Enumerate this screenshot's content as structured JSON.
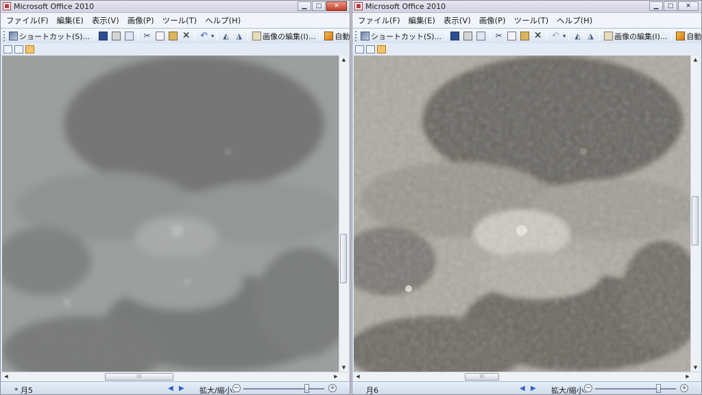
{
  "left": {
    "title": "Microsoft Office 2010",
    "title_buttons": {
      "minimize": "▁",
      "maximize": "□",
      "close": "✕"
    },
    "menus": [
      "ファイル(F)",
      "編集(E)",
      "表示(V)",
      "画像(P)",
      "ツール(T)",
      "ヘルプ(H)"
    ],
    "toolbar": {
      "shortcut": "ショートカット(S)...",
      "edit_image": "画像の編集(I)...",
      "auto_correct": "自動修正(A)"
    },
    "status": {
      "label": "* 月5",
      "zoom_label": "拡大/縮小:",
      "zoom_out": "−",
      "zoom_in": "+",
      "prev": "◀",
      "next": "▶",
      "grip": "⁞⁞⁞"
    },
    "zoom_level": 0.78,
    "undo_enabled": true
  },
  "right": {
    "title": "Microsoft Office 2010",
    "title_buttons": {
      "minimize": "▁",
      "maximize": "□",
      "close": "✕"
    },
    "menus": [
      "ファイル(F)",
      "編集(E)",
      "表示(V)",
      "画像(P)",
      "ツール(T)",
      "ヘルプ(H)"
    ],
    "toolbar": {
      "shortcut": "ショートカット(S)...",
      "edit_image": "画像の編集(I)...",
      "auto_correct": "自動修正(A)"
    },
    "status": {
      "label": "月6",
      "zoom_label": "拡大/縮小:",
      "zoom_out": "−",
      "zoom_in": "+",
      "prev": "◀",
      "next": "▶",
      "grip": "⁞⁞⁞"
    },
    "zoom_level": 0.78,
    "undo_enabled": false
  },
  "icons": {
    "app": "office-app-icon",
    "cut": "✂",
    "delete": "✕",
    "undo": "↶",
    "rotate_left": "◭",
    "rotate_right": "◮"
  },
  "colors": {
    "accent": "#2a62c6",
    "close_red": "#c43b26",
    "active_view": "#f6c56b"
  }
}
